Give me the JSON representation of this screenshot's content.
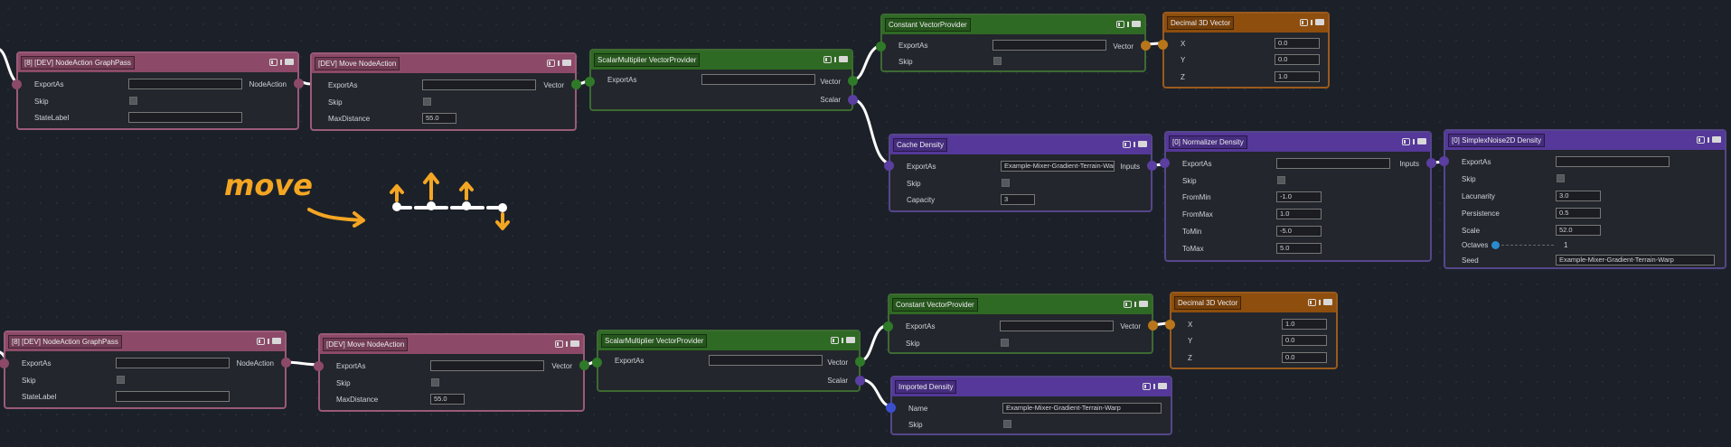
{
  "colors": {
    "canvas_bg": "#1c2129",
    "pink": "#8c4a68",
    "green": "#2f6a24",
    "orange": "#8e4e0e",
    "purple": "#55389a",
    "wire": "#ffffff",
    "annotation": "#f4a623"
  },
  "annotation": {
    "text": "move"
  },
  "header_icons": {
    "toggle": "toggle-icon",
    "info": "info-icon",
    "comment": "comment-icon"
  },
  "top": {
    "graphpass": {
      "title": "[8] [DEV] NodeAction GraphPass",
      "rows": [
        {
          "label": "ExportAs",
          "value": ""
        },
        {
          "label": "Skip"
        },
        {
          "label": "StateLabel",
          "value": ""
        }
      ],
      "output": "NodeAction"
    },
    "move": {
      "title": "[DEV] Move NodeAction",
      "rows": [
        {
          "label": "ExportAs",
          "value": ""
        },
        {
          "label": "Skip"
        },
        {
          "label": "MaxDistance",
          "value": "55.0"
        }
      ],
      "output": "Vector"
    },
    "scalarmult": {
      "title": "ScalarMultiplier VectorProvider",
      "rows": [
        {
          "label": "ExportAs",
          "value": ""
        }
      ],
      "outputs": [
        "Vector",
        "Scalar"
      ]
    },
    "constvec": {
      "title": "Constant VectorProvider",
      "rows": [
        {
          "label": "ExportAs",
          "value": ""
        },
        {
          "label": "Skip"
        }
      ],
      "output": "Vector"
    },
    "dec3d": {
      "title": "Decimal 3D Vector",
      "rows": [
        {
          "label": "X",
          "value": "0.0"
        },
        {
          "label": "Y",
          "value": "0.0"
        },
        {
          "label": "Z",
          "value": "1.0"
        }
      ]
    },
    "cache": {
      "title": "Cache Density",
      "rows": [
        {
          "label": "ExportAs",
          "value": "Example-Mixer-Gradient-Terrain-Warp"
        },
        {
          "label": "Skip"
        },
        {
          "label": "Capacity",
          "value": "3"
        }
      ],
      "output": "Inputs"
    },
    "normalizer": {
      "title": "[0] Normalizer Density",
      "rows": [
        {
          "label": "ExportAs",
          "value": ""
        },
        {
          "label": "Skip"
        },
        {
          "label": "FromMin",
          "value": "-1.0"
        },
        {
          "label": "FromMax",
          "value": "1.0"
        },
        {
          "label": "ToMin",
          "value": "-5.0"
        },
        {
          "label": "ToMax",
          "value": "5.0"
        }
      ],
      "output": "Inputs"
    },
    "simplex": {
      "title": "[0] SimplexNoise2D Density",
      "rows": [
        {
          "label": "ExportAs",
          "value": ""
        },
        {
          "label": "Skip"
        },
        {
          "label": "Lacunarity",
          "value": "3.0"
        },
        {
          "label": "Persistence",
          "value": "0.5"
        },
        {
          "label": "Scale",
          "value": "52.0"
        },
        {
          "label": "Octaves",
          "value": "1"
        },
        {
          "label": "Seed",
          "value": "Example-Mixer-Gradient-Terrain-Warp"
        }
      ],
      "octaves_level": 0.05
    }
  },
  "bottom": {
    "graphpass": {
      "title": "[8] [DEV] NodeAction GraphPass",
      "rows": [
        {
          "label": "ExportAs",
          "value": ""
        },
        {
          "label": "Skip"
        },
        {
          "label": "StateLabel",
          "value": ""
        }
      ],
      "output": "NodeAction"
    },
    "move": {
      "title": "[DEV] Move NodeAction",
      "rows": [
        {
          "label": "ExportAs",
          "value": ""
        },
        {
          "label": "Skip"
        },
        {
          "label": "MaxDistance",
          "value": "55.0"
        }
      ],
      "output": "Vector"
    },
    "scalarmult": {
      "title": "ScalarMultiplier VectorProvider",
      "rows": [
        {
          "label": "ExportAs",
          "value": ""
        }
      ],
      "outputs": [
        "Vector",
        "Scalar"
      ]
    },
    "constvec": {
      "title": "Constant VectorProvider",
      "rows": [
        {
          "label": "ExportAs",
          "value": ""
        },
        {
          "label": "Skip"
        }
      ],
      "output": "Vector"
    },
    "dec3d": {
      "title": "Decimal 3D Vector",
      "rows": [
        {
          "label": "X",
          "value": "1.0"
        },
        {
          "label": "Y",
          "value": "0.0"
        },
        {
          "label": "Z",
          "value": "0.0"
        }
      ]
    },
    "imported": {
      "title": "Imported Density",
      "rows": [
        {
          "label": "Name",
          "value": "Example-Mixer-Gradient-Terrain-Warp"
        },
        {
          "label": "Skip"
        }
      ]
    }
  }
}
